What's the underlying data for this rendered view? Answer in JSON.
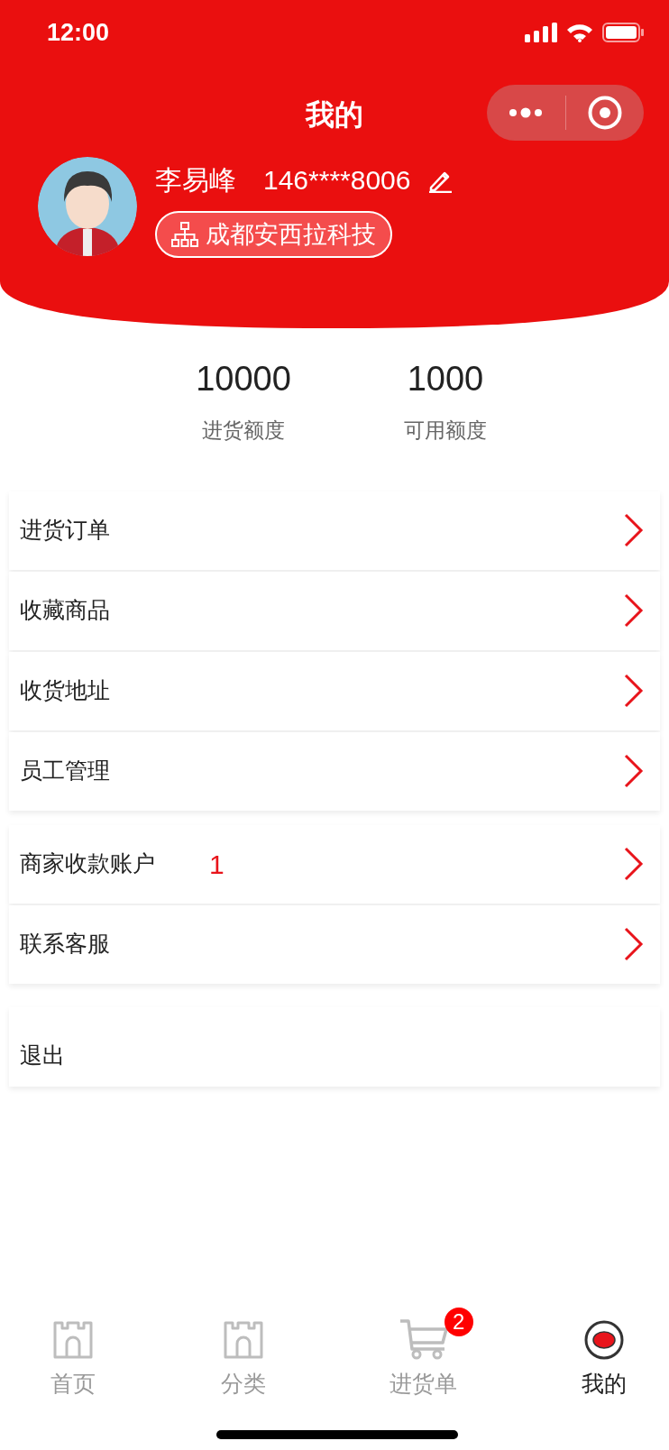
{
  "status_bar": {
    "time": "12:00"
  },
  "title": "我的",
  "profile": {
    "name": "李易峰",
    "phone": "146****8006",
    "company": "成都安西拉科技"
  },
  "stats": [
    {
      "value": "10000",
      "label": "进货额度"
    },
    {
      "value": "1000",
      "label": "可用额度"
    }
  ],
  "menu_groups": [
    [
      {
        "label": "进货订单"
      },
      {
        "label": "收藏商品"
      },
      {
        "label": "收货地址"
      },
      {
        "label": "员工管理"
      }
    ],
    [
      {
        "label": "商家收款账户",
        "badge": "1"
      },
      {
        "label": "联系客服"
      }
    ]
  ],
  "logout": "退出",
  "tabs": [
    {
      "label": "首页",
      "kind": "castle",
      "selected": false
    },
    {
      "label": "分类",
      "kind": "castle",
      "selected": false
    },
    {
      "label": "进货单",
      "kind": "cart",
      "selected": false,
      "badge": "2"
    },
    {
      "label": "我的",
      "kind": "user",
      "selected": true
    }
  ]
}
